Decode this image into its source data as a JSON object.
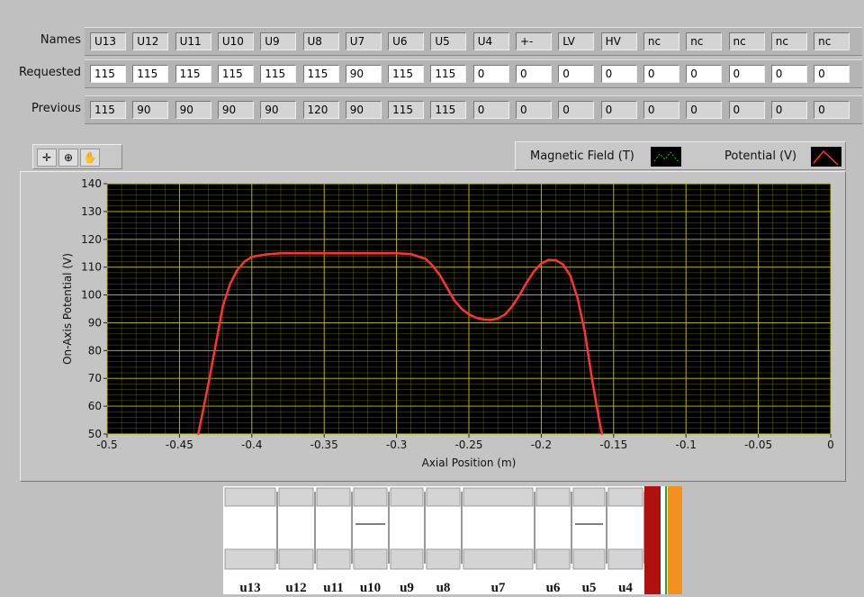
{
  "table": {
    "rows": [
      {
        "label": "Names",
        "style": "indicator",
        "values": [
          "U13",
          "U12",
          "U11",
          "U10",
          "U9",
          "U8",
          "U7",
          "U6",
          "U5",
          "U4",
          "+-",
          "LV",
          "HV",
          "nc",
          "nc",
          "nc",
          "nc",
          "nc"
        ]
      },
      {
        "label": "Requested",
        "style": "control",
        "values": [
          "115",
          "115",
          "115",
          "115",
          "115",
          "115",
          "90",
          "115",
          "115",
          "0",
          "0",
          "0",
          "0",
          "0",
          "0",
          "0",
          "0",
          "0"
        ]
      },
      {
        "label": "Previous",
        "style": "indicator",
        "values": [
          "115",
          "90",
          "90",
          "90",
          "90",
          "120",
          "90",
          "115",
          "115",
          "0",
          "0",
          "0",
          "0",
          "0",
          "0",
          "0",
          "0",
          "0"
        ]
      }
    ]
  },
  "toolbar": {
    "tools": [
      {
        "icon": "crosshair-icon",
        "glyph": "✛"
      },
      {
        "icon": "zoom-icon",
        "glyph": "⊕"
      },
      {
        "icon": "pan-hand-icon",
        "glyph": "✋"
      }
    ]
  },
  "legend": {
    "items": [
      {
        "label": "Magnetic Field (T)",
        "color": "#22cc22"
      },
      {
        "label": "Potential (V)",
        "color": "#ff3333"
      }
    ]
  },
  "chart_data": {
    "type": "line",
    "xlabel": "Axial Position (m)",
    "ylabel": "On-Axis Potential (V)",
    "xlim": [
      -0.5,
      0
    ],
    "ylim": [
      50,
      140
    ],
    "xticks": [
      "-0.5",
      "-0.45",
      "-0.4",
      "-0.35",
      "-0.3",
      "-0.25",
      "-0.2",
      "-0.15",
      "-0.1",
      "-0.05",
      "0"
    ],
    "yticks": [
      "50",
      "60",
      "70",
      "80",
      "90",
      "100",
      "110",
      "120",
      "130",
      "140"
    ],
    "grid": true,
    "background": "#000000",
    "grid_color": "#c8c800",
    "series": [
      {
        "name": "Potential (V)",
        "color": "#ff3333",
        "x": [
          -0.437,
          -0.43,
          -0.425,
          -0.42,
          -0.415,
          -0.41,
          -0.405,
          -0.4,
          -0.39,
          -0.38,
          -0.35,
          -0.3,
          -0.29,
          -0.28,
          -0.275,
          -0.27,
          -0.265,
          -0.26,
          -0.255,
          -0.25,
          -0.245,
          -0.24,
          -0.235,
          -0.23,
          -0.225,
          -0.22,
          -0.215,
          -0.21,
          -0.205,
          -0.2,
          -0.195,
          -0.19,
          -0.185,
          -0.18,
          -0.175,
          -0.17,
          -0.165,
          -0.16,
          -0.158
        ],
        "y": [
          50,
          68,
          82,
          96,
          104,
          109,
          112,
          113.7,
          114.6,
          115,
          115,
          115,
          114.7,
          113,
          110.5,
          107,
          102.5,
          98,
          95,
          93,
          91.8,
          91.2,
          91,
          91.5,
          93,
          96,
          100,
          104.5,
          108.5,
          111.3,
          112.6,
          112.5,
          111,
          107,
          99,
          87,
          70,
          55,
          50
        ]
      }
    ]
  },
  "beamline": {
    "labels": [
      "u13",
      "u12",
      "u11",
      "u10",
      "u9",
      "u8",
      "u7",
      "u6",
      "u5",
      "u4"
    ]
  }
}
